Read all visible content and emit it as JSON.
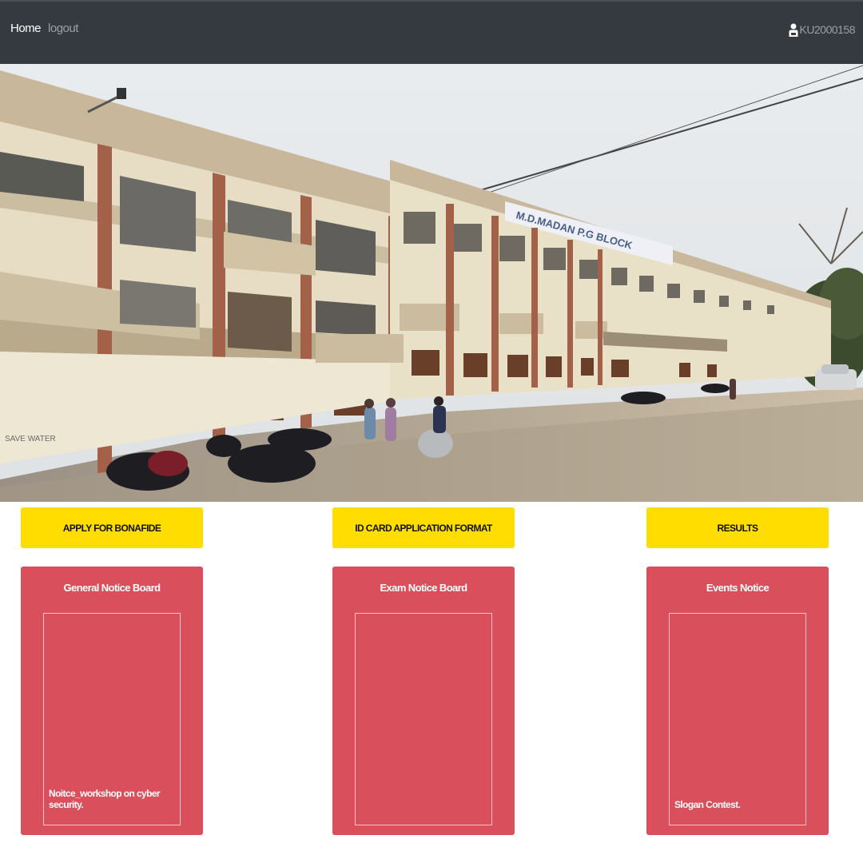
{
  "navbar": {
    "home_label": "Home",
    "logout_label": "logout",
    "user_id": "KU2000158",
    "background": "#343a40"
  },
  "hero": {
    "building_sign": "M.D.MADAN P.G BLOCK",
    "wall_graffiti": "SAVE WATER"
  },
  "buttons": [
    {
      "label": "APPLY FOR BONAFIDE"
    },
    {
      "label": "ID CARD APPLICATION FORMAT"
    },
    {
      "label": "RESULTS"
    }
  ],
  "notice_boards": [
    {
      "title": "General Notice Board",
      "items": [
        "Noitce_workshop on cyber security."
      ]
    },
    {
      "title": "Exam Notice Board",
      "items": []
    },
    {
      "title": "Events Notice",
      "items": [
        "Slogan Contest."
      ]
    }
  ],
  "colors": {
    "button_yellow": "#ffdd00",
    "card_red": "#d94f5b"
  }
}
